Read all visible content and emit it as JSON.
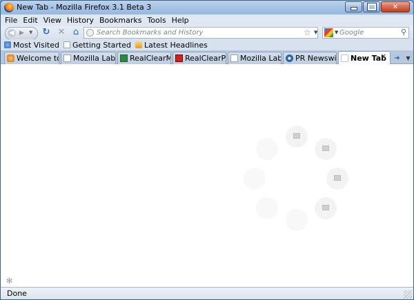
{
  "window": {
    "title": "New Tab - Mozilla Firefox 3.1 Beta 3"
  },
  "menu": [
    "File",
    "Edit",
    "View",
    "History",
    "Bookmarks",
    "Tools",
    "Help"
  ],
  "nav": {
    "url_placeholder": "Search Bookmarks and History",
    "search_placeholder": "Google"
  },
  "bookmarks": [
    {
      "label": "Most Visited",
      "icon": "most-visited-icon"
    },
    {
      "label": "Getting Started",
      "icon": "page-icon"
    },
    {
      "label": "Latest Headlines",
      "icon": "rss-folder-icon"
    }
  ],
  "tabs": [
    {
      "label": "Welcome to ...",
      "icon": "welcome-favicon"
    },
    {
      "label": "Mozilla Labs ...",
      "icon": "page-icon"
    },
    {
      "label": "RealClearMa...",
      "icon": "realclearmarkets-favicon"
    },
    {
      "label": "RealClearPoli...",
      "icon": "realclearpolitics-favicon"
    },
    {
      "label": "Mozilla Labs ...",
      "icon": "page-icon"
    },
    {
      "label": "PR Newswire...",
      "icon": "prnewswire-favicon"
    },
    {
      "label": "New Tab",
      "icon": "new-tab-favicon",
      "selected": true
    }
  ],
  "status": {
    "text": "Done"
  },
  "colors": {
    "titlebar": "#a6c3e4",
    "chrome": "#d8e2ee",
    "content": "#ffffff"
  }
}
